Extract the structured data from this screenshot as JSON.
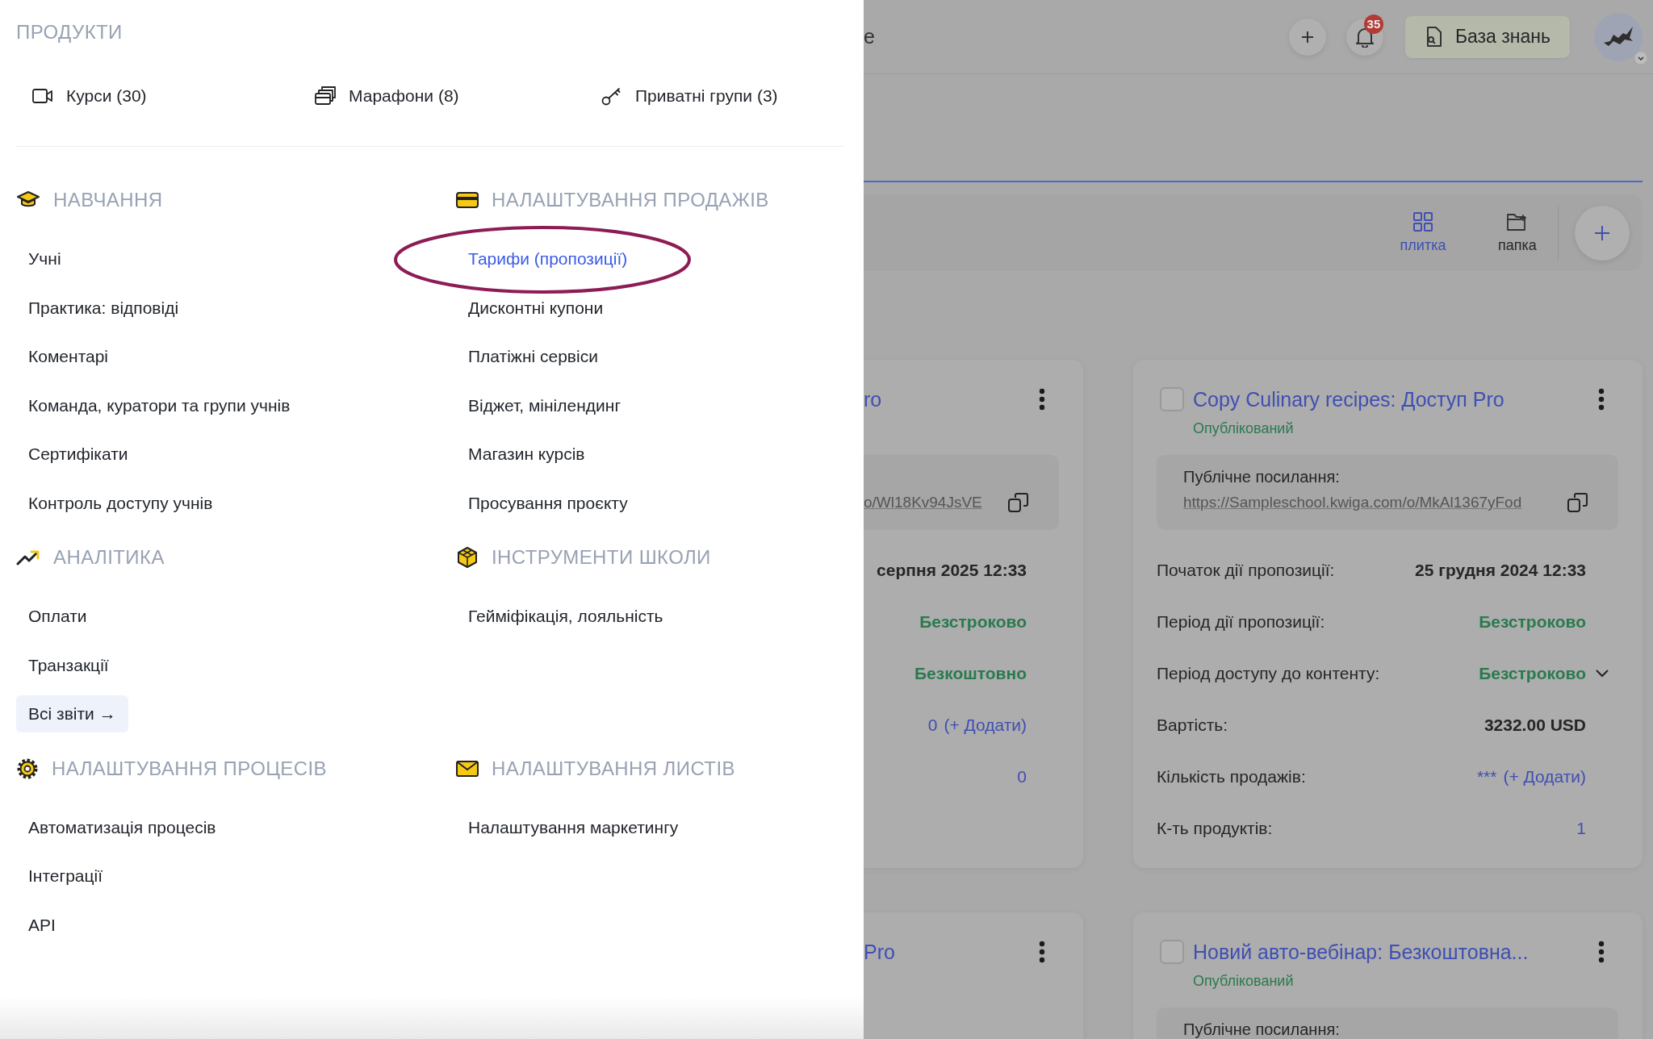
{
  "products": {
    "heading": "ПРОДУКТИ",
    "items": [
      {
        "kind": "video",
        "label": "Курси (30)"
      },
      {
        "kind": "stack",
        "label": "Марафони (8)"
      },
      {
        "kind": "key",
        "label": "Приватні групи (3)"
      }
    ]
  },
  "sections": [
    {
      "kind": "graduation",
      "heading": "НАВЧАННЯ",
      "items": [
        {
          "label": "Учні",
          "selected": false,
          "circled": false
        },
        {
          "label": "Практика: відповіді",
          "selected": false,
          "circled": false
        },
        {
          "label": "Коментарі",
          "selected": false,
          "circled": false
        },
        {
          "label": "Команда, куратори та групи учнів",
          "selected": false,
          "circled": false
        },
        {
          "label": "Сертифікати",
          "selected": false,
          "circled": false
        },
        {
          "label": "Контроль доступу учнів",
          "selected": false,
          "circled": false
        }
      ]
    },
    {
      "kind": "card",
      "heading": "НАЛАШТУВАННЯ ПРОДАЖІВ",
      "items": [
        {
          "label": "Тарифи (пропозиції)",
          "selected": true,
          "circled": true
        },
        {
          "label": "Дисконтні купони",
          "selected": false,
          "circled": false
        },
        {
          "label": "Платіжні сервіси",
          "selected": false,
          "circled": false
        },
        {
          "label": "Віджет, мінілендинг",
          "selected": false,
          "circled": false
        },
        {
          "label": "Магазин курсів",
          "selected": false,
          "circled": false
        },
        {
          "label": "Просування проєкту",
          "selected": false,
          "circled": false
        }
      ]
    },
    {
      "kind": "trend",
      "heading": "АНАЛІТИКА",
      "items": [
        {
          "label": "Оплати",
          "selected": false,
          "circled": false
        },
        {
          "label": "Транзакції",
          "selected": false,
          "circled": false
        }
      ],
      "button": "Всі звіти →"
    },
    {
      "kind": "cube",
      "heading": "ІНСТРУМЕНТИ ШКОЛИ",
      "items": [
        {
          "label": "Гейміфікація, лояльність",
          "selected": false,
          "circled": false
        }
      ]
    },
    {
      "kind": "gear",
      "heading": "НАЛАШТУВАННЯ ПРОЦЕСІВ",
      "items": [
        {
          "label": "Автоматизація процесів",
          "selected": false,
          "circled": false
        },
        {
          "label": "Інтеграції",
          "selected": false,
          "circled": false
        },
        {
          "label": "API",
          "selected": false,
          "circled": false
        }
      ]
    },
    {
      "kind": "mail",
      "heading": "НАЛАШТУВАННЯ ЛИСТІВ",
      "items": [
        {
          "label": "Налаштування маркетингу",
          "selected": false,
          "circled": false
        }
      ]
    }
  ],
  "header": {
    "title": "e",
    "notifications": "35",
    "knowledge_base": "База знань"
  },
  "view_switch": [
    {
      "kind": "grid",
      "label": "плитка",
      "selected": true
    },
    {
      "kind": "folder",
      "label": "папка",
      "selected": false
    }
  ],
  "cards": [
    {
      "title": "ro",
      "link": "o/Wl18Kv94JsVE",
      "rows": [
        {
          "kind": "date",
          "value": "серпня 2025 12:33"
        },
        {
          "kind": "status",
          "value": "Безстроково"
        },
        {
          "kind": "status",
          "value": "Безкоштовно"
        },
        {
          "kind": "count",
          "value": "0",
          "action": "(+ Додати)"
        },
        {
          "kind": "number",
          "value": "0"
        }
      ]
    },
    {
      "checked": false,
      "title": "Copy Culinary recipes: Доступ Pro",
      "status": "Опублікований",
      "link_label": "Публічне посилання:",
      "link": "https://Sampleschool.kwiga.com/o/MkAl1367yFod",
      "rows": [
        {
          "kind": "date",
          "label": "Початок дії пропозиції:",
          "value": "25 грудня 2024 12:33"
        },
        {
          "kind": "status",
          "label": "Період дії пропозиції:",
          "value": "Безстроково"
        },
        {
          "kind": "select",
          "label": "Період доступу до контенту:",
          "value": "Безстроково"
        },
        {
          "kind": "price",
          "label": "Вартість:",
          "value": "3232.00 USD"
        },
        {
          "kind": "count",
          "label": "Кількість продажів:",
          "value": "***",
          "action": "(+ Додати)"
        },
        {
          "kind": "number",
          "label": "К-ть продуктів:",
          "value": "1"
        }
      ]
    },
    {
      "title": "Pro"
    },
    {
      "checked": false,
      "title": "Новий авто-вебінар: Безкоштовна...",
      "status": "Опублікований",
      "link_label": "Публічне посилання:"
    }
  ]
}
